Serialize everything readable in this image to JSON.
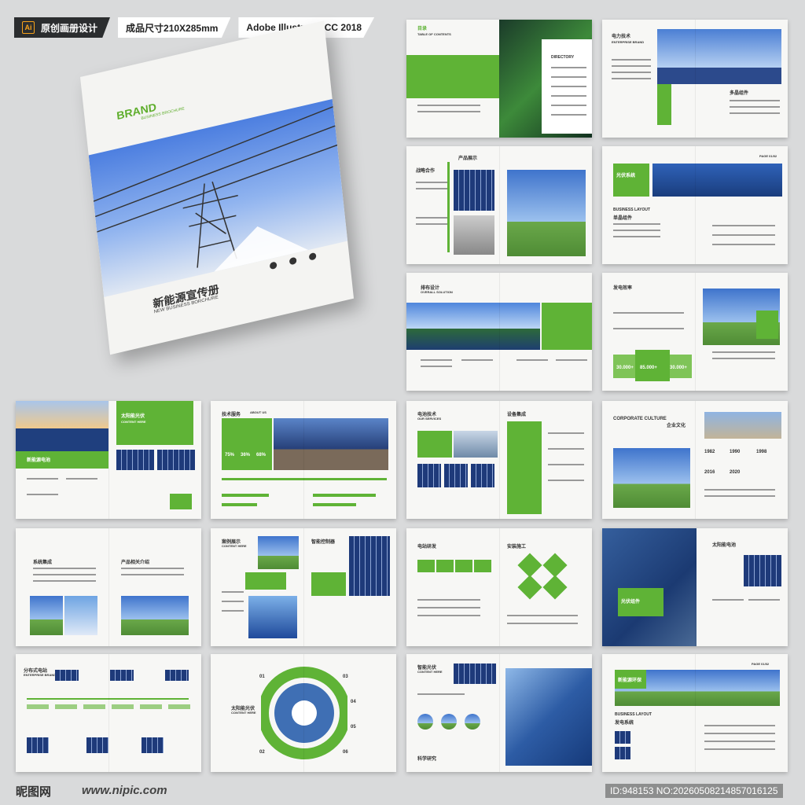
{
  "header": {
    "tag1": "原创画册设计",
    "tag2": "成品尺寸210X285mm",
    "tag3": "Adobe Illustrator CC 2018",
    "ai_label": "Ai"
  },
  "cover": {
    "brand": "BRAND",
    "brand_sub": "BUSINESS BROCHURE",
    "title": "新能源宣传册",
    "subtitle": "NEW BUSINESS BORCHURE"
  },
  "spreads": {
    "s1_title": "目录",
    "s1_sub": "TABLE OF CONTENTS",
    "s1_directory": "DIRECTORY",
    "s2_title": "电力技术",
    "s2_sub": "ENTERPRISE BRAND",
    "s2_caption": "多晶组件",
    "s3_title": "战略合作",
    "s3_caption": "产品展示",
    "s4_title": "光伏系统",
    "s4_layout": "BUSINESS LAYOUT",
    "s4_layout_cn": "单晶组件",
    "s4_page": "PAGE 01/02",
    "s5_title": "排布设计",
    "s5_sub": "OVERALL SOLUTION",
    "s6_title": "发电效率",
    "s6_stat1": "30.000+",
    "s6_stat2": "85.000+",
    "s6_stat3": "30.000+",
    "s7_title": "太阳能光伏",
    "s7_sub": "CONTENT HERE",
    "s7_caption": "新能源电池",
    "s8_title": "技术服务",
    "s8_sub": "ABOUT US",
    "s8_p1": "75%",
    "s8_p2": "36%",
    "s8_p3": "68%",
    "s9_title": "电池技术",
    "s9_sub": "OUR SERVICES",
    "s9_right": "设备集成",
    "s10_title": "CORPORATE CULTURE",
    "s10_cn": "企业文化",
    "s10_y1": "1982",
    "s10_y2": "1990",
    "s10_y3": "1998",
    "s10_y4": "2016",
    "s10_y5": "2020",
    "s11_title": "系统集成",
    "s11_right": "产品相关介绍",
    "s12_title": "案例展示",
    "s12_sub": "CONTENT HERE",
    "s12_right": "智能控制器",
    "s13_title": "电站研发",
    "s13_right": "安装施工",
    "s14_title": "太阳能电池",
    "s14_caption": "光伏组件",
    "s15_title": "分布式电站",
    "s15_sub": "ENTERPRISE BRAND",
    "s16_title": "太阳能光伏",
    "s16_sub": "CONTENT HERE",
    "s16_n1": "01",
    "s16_n2": "02",
    "s16_n3": "03",
    "s16_n4": "04",
    "s16_n5": "05",
    "s16_n6": "06",
    "s17_title": "智能光伏",
    "s17_sub": "CONTENT HERE",
    "s17_caption": "科学研究",
    "s18_title": "新能源环保",
    "s18_layout": "BUSINESS LAYOUT",
    "s18_layout_cn": "发电系统",
    "s18_page": "PAGE 01/02"
  },
  "footer": {
    "logo": "昵图网",
    "url": "www.nipic.com",
    "id": "ID:948153 NO:20260508214857016125"
  },
  "colors": {
    "accent": "#5fb336",
    "dark": "#2b2d2f"
  }
}
